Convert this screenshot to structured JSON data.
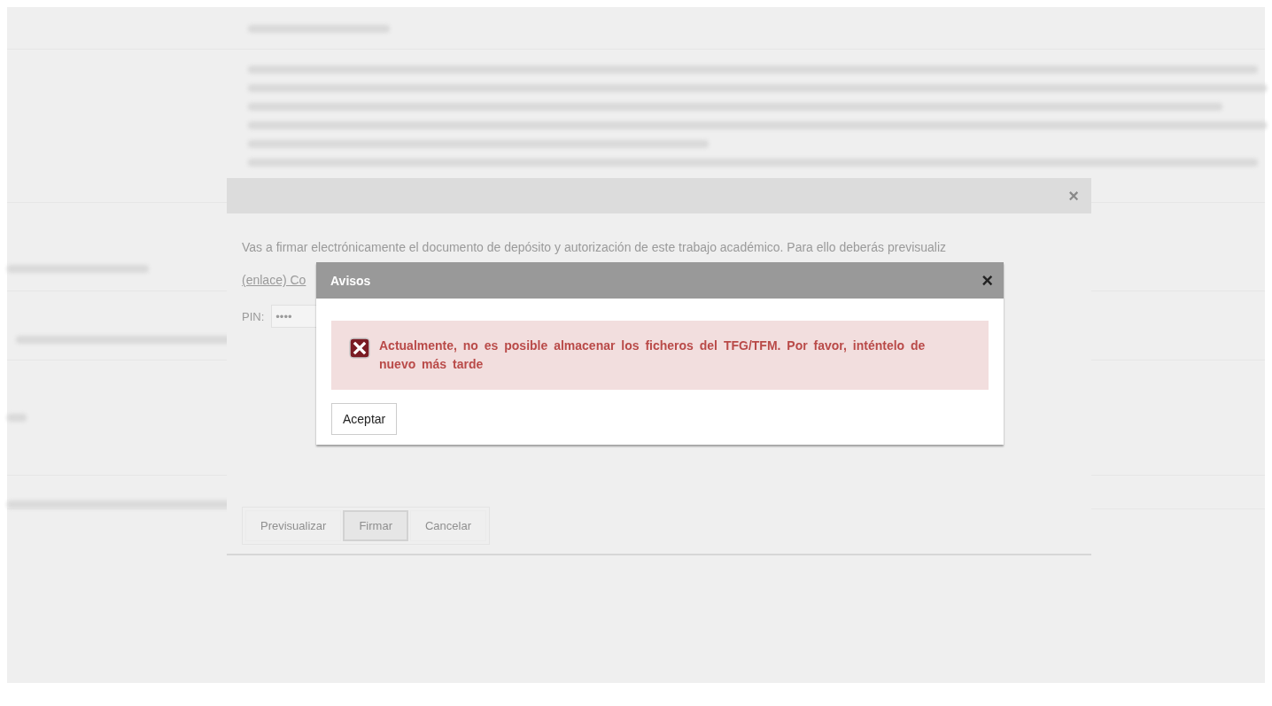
{
  "sign_dialog": {
    "close": "×",
    "intro": "Vas a firmar electrónicamente el documento de depósito y autorización de este trabajo académico. Para ello deberás previsualiz",
    "link": "(enlace) Co",
    "pin": {
      "label": "PIN:",
      "value": "••••"
    },
    "buttons": [
      {
        "label": "Previsualizar",
        "selected": false
      },
      {
        "label": "Firmar",
        "selected": true
      },
      {
        "label": "Cancelar",
        "selected": false
      }
    ]
  },
  "alert": {
    "title": "Avisos",
    "close": "×",
    "kind": "error",
    "message": "Actualmente, no es posible almacenar los ficheros del TFG/TFM. Por favor, inténtelo de nuevo más tarde",
    "button": "Aceptar"
  }
}
